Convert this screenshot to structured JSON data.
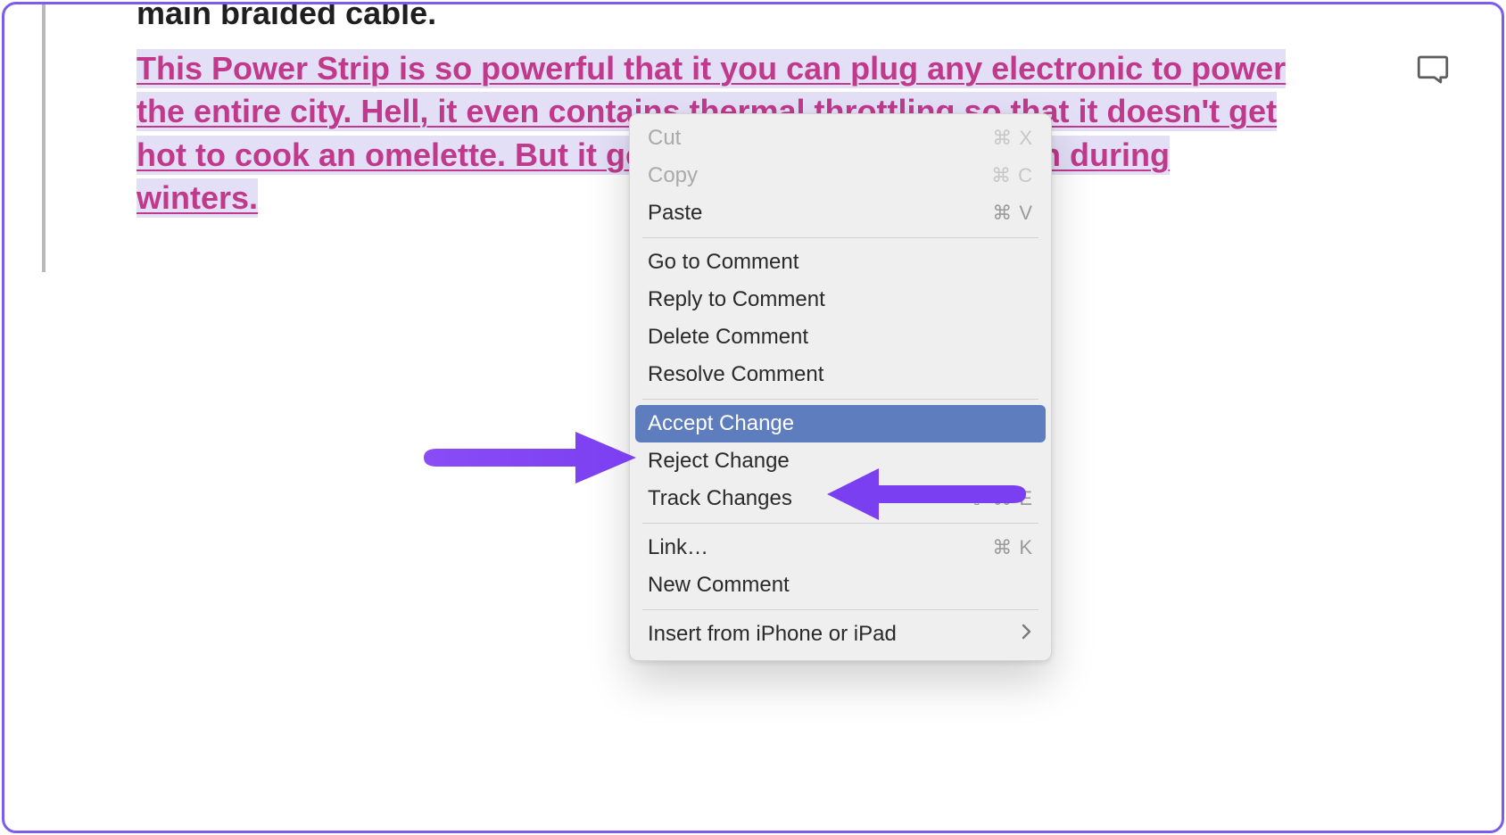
{
  "document": {
    "prev_line_fragment": "main braided cable.",
    "tracked_text": "This Power Strip is so powerful that it you can plug any electronic to power the entire city. Hell, it even contains thermal throttling so that it doesn't get hot to cook an omelette. But it gets warm enough to cook on during winters."
  },
  "context_menu": {
    "cut": {
      "label": "Cut",
      "shortcut": "⌘ X",
      "enabled": false
    },
    "copy": {
      "label": "Copy",
      "shortcut": "⌘ C",
      "enabled": false
    },
    "paste": {
      "label": "Paste",
      "shortcut": "⌘ V",
      "enabled": true
    },
    "go_to_comment": {
      "label": "Go to Comment"
    },
    "reply_comment": {
      "label": "Reply to Comment"
    },
    "delete_comment": {
      "label": "Delete Comment"
    },
    "resolve_comment": {
      "label": "Resolve Comment"
    },
    "accept_change": {
      "label": "Accept Change"
    },
    "reject_change": {
      "label": "Reject Change"
    },
    "track_changes": {
      "label": "Track Changes",
      "shortcut": "⇧ ⌘ E"
    },
    "link": {
      "label": "Link…",
      "shortcut": "⌘ K"
    },
    "new_comment": {
      "label": "New Comment"
    },
    "insert_device": {
      "label": "Insert from iPhone or iPad"
    }
  },
  "icons": {
    "comment_bubble": "comment-icon",
    "submenu_chevron": "chevron-right-icon"
  },
  "annotations": {
    "arrow_left_target": "accept_change",
    "arrow_right_target": "reject_change"
  },
  "colors": {
    "frame_border": "#7B5CF0",
    "tracked_text": "#C0398B",
    "highlight_bg": "#5E7DBE",
    "menu_bg": "#efefef",
    "arrow": "#7B3FF2"
  }
}
